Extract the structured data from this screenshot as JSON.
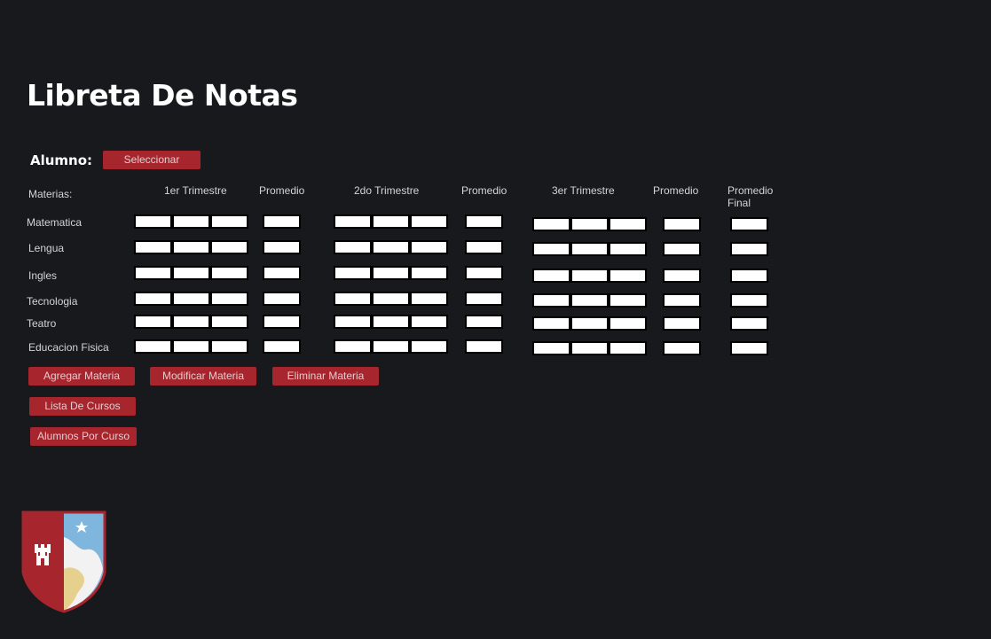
{
  "page": {
    "title": "Libreta De Notas"
  },
  "student": {
    "label": "Alumno:",
    "select_button": "Seleccionar"
  },
  "table": {
    "subjects_header": "Materias:",
    "columns": {
      "t1": "1er Trimestre",
      "p1": "Promedio",
      "t2": "2do Trimestre",
      "p2": "Promedio",
      "t3": "3er Trimestre",
      "p3": "Promedio",
      "final": "Promedio\nFinal"
    },
    "subjects": [
      "Matematica",
      "Lengua",
      "Ingles",
      "Tecnologia",
      "Teatro",
      "Educacion Fisica"
    ]
  },
  "actions": {
    "add_subject": "Agregar Materia",
    "modify_subject": "Modificar Materia",
    "delete_subject": "Eliminar Materia",
    "course_list": "Lista De Cursos",
    "students_by_course": "Alumnos Por Curso"
  },
  "colors": {
    "background": "#17191c",
    "accent_red": "#a7262e",
    "crest_blue": "#7fb6de",
    "crest_cream": "#e6d08d"
  },
  "crest": {
    "icons": [
      "castle-icon",
      "star-icon"
    ]
  }
}
